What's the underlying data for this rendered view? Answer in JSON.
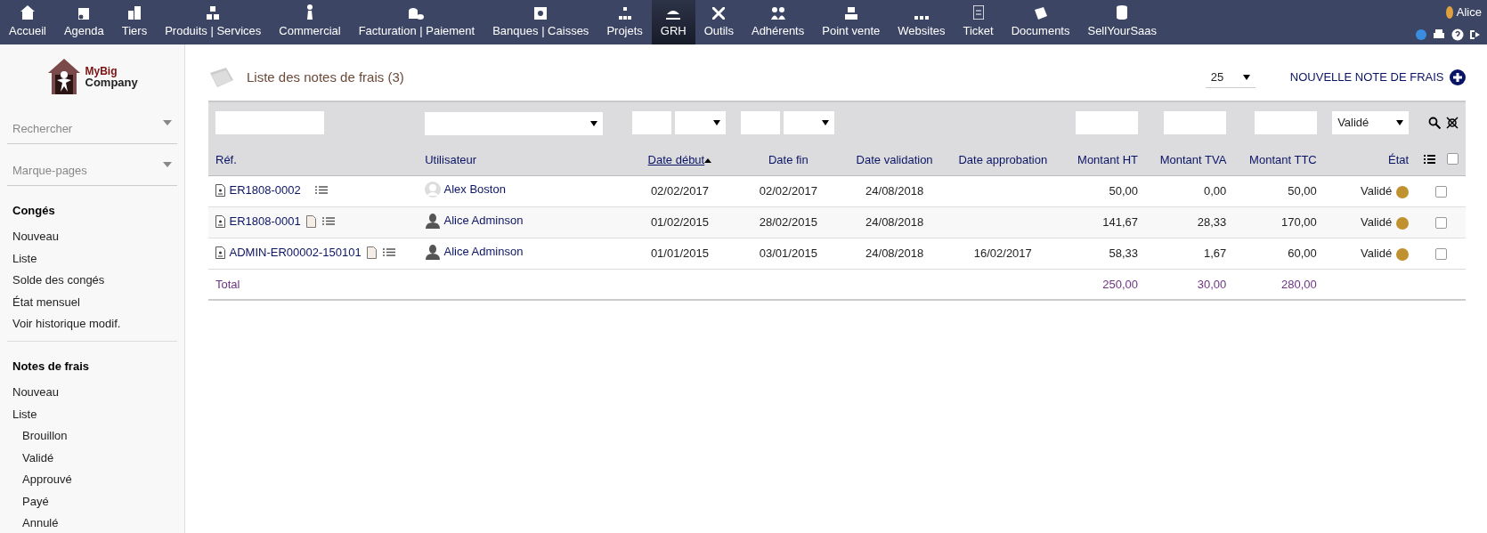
{
  "top_menu": [
    {
      "label": "Accueil",
      "selected": false
    },
    {
      "label": "Agenda",
      "selected": false
    },
    {
      "label": "Tiers",
      "selected": false
    },
    {
      "label": "Produits | Services",
      "selected": false
    },
    {
      "label": "Commercial",
      "selected": false
    },
    {
      "label": "Facturation | Paiement",
      "selected": false
    },
    {
      "label": "Banques | Caisses",
      "selected": false
    },
    {
      "label": "Projets",
      "selected": false
    },
    {
      "label": "GRH",
      "selected": true
    },
    {
      "label": "Outils",
      "selected": false
    },
    {
      "label": "Adhérents",
      "selected": false
    },
    {
      "label": "Point vente",
      "selected": false
    },
    {
      "label": "Websites",
      "selected": false
    },
    {
      "label": "Ticket",
      "selected": false
    },
    {
      "label": "Documents",
      "selected": false
    },
    {
      "label": "SellYourSaas",
      "selected": false
    }
  ],
  "user": {
    "name": "Alice"
  },
  "logo": {
    "line_1": "MyBig",
    "line_2": "Company"
  },
  "sidebar": {
    "search": {
      "placeholder": "Rechercher"
    },
    "bookmarks": {
      "placeholder": "Marque-pages"
    },
    "sections": [
      {
        "title": "Congés",
        "items": [
          {
            "label": "Nouveau"
          },
          {
            "label": "Liste"
          },
          {
            "label": "Solde des congés"
          },
          {
            "label": "État mensuel"
          },
          {
            "label": "Voir historique modif."
          }
        ]
      },
      {
        "title": "Notes de frais",
        "items": [
          {
            "label": "Nouveau"
          },
          {
            "label": "Liste",
            "children": [
              {
                "label": "Brouillon"
              },
              {
                "label": "Validé"
              },
              {
                "label": "Approuvé"
              },
              {
                "label": "Payé"
              },
              {
                "label": "Annulé"
              }
            ]
          }
        ]
      }
    ]
  },
  "page": {
    "title": "Liste des notes de frais (3)",
    "per_page": "25",
    "new_button": "NOUVELLE NOTE DE FRAIS"
  },
  "filters": {
    "status": "Validé"
  },
  "table": {
    "select_all": {
      "checked": false
    },
    "columns": [
      {
        "label": "Réf.",
        "sorted": false
      },
      {
        "label": "Utilisateur",
        "sorted": false
      },
      {
        "label": "Date début",
        "sorted": true
      },
      {
        "label": "Date fin",
        "sorted": false
      },
      {
        "label": "Date validation",
        "sorted": false
      },
      {
        "label": "Date approbation",
        "sorted": false
      },
      {
        "label": "Montant HT",
        "sorted": false
      },
      {
        "label": "Montant TVA",
        "sorted": false
      },
      {
        "label": "Montant TTC",
        "sorted": false
      },
      {
        "label": "État",
        "sorted": false
      }
    ],
    "rows": [
      {
        "ref": "ER1808-0002",
        "has_file": false,
        "user": "Alex Boston",
        "photo_placeholder": true,
        "date_start": "02/02/2017",
        "date_end": "02/02/2017",
        "date_validation": "24/08/2018",
        "date_approval": "",
        "amount_ht": "50,00",
        "amount_tva": "0,00",
        "amount_ttc": "50,00",
        "status": "Validé",
        "color": "#c0912f",
        "checked": false
      },
      {
        "ref": "ER1808-0001",
        "has_file": true,
        "user": "Alice Adminson",
        "photo_placeholder": false,
        "date_start": "01/02/2015",
        "date_end": "28/02/2015",
        "date_validation": "24/08/2018",
        "date_approval": "",
        "amount_ht": "141,67",
        "amount_tva": "28,33",
        "amount_ttc": "170,00",
        "status": "Validé",
        "color": "#c0912f",
        "checked": false
      },
      {
        "ref": "ADMIN-ER00002-150101",
        "has_file": true,
        "user": "Alice Adminson",
        "photo_placeholder": false,
        "date_start": "01/01/2015",
        "date_end": "03/01/2015",
        "date_validation": "24/08/2018",
        "date_approval": "16/02/2017",
        "amount_ht": "58,33",
        "amount_tva": "1,67",
        "amount_ttc": "60,00",
        "status": "Validé",
        "color": "#c0912f",
        "checked": false
      }
    ],
    "total": {
      "label": "Total",
      "amount_ht": "250,00",
      "amount_tva": "30,00",
      "amount_ttc": "280,00"
    }
  }
}
